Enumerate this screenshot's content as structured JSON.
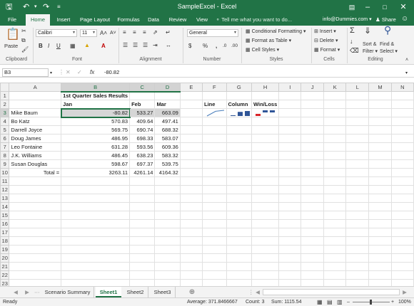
{
  "title_bar": {
    "title": "SampleExcel - Excel"
  },
  "tabs": [
    "File",
    "Home",
    "Insert",
    "Page Layout",
    "Formulas",
    "Data",
    "Review",
    "View"
  ],
  "tell_me": "Tell me what you want to do...",
  "user": "info@Dummies.com",
  "share": "Share",
  "ribbon": {
    "clipboard": {
      "label": "Clipboard",
      "paste": "Paste"
    },
    "font": {
      "label": "Font",
      "name": "Calibri",
      "size": "11"
    },
    "alignment": {
      "label": "Alignment"
    },
    "number": {
      "label": "Number",
      "format": "General"
    },
    "styles": {
      "label": "Styles",
      "conditional": "Conditional Formatting",
      "format_table": "Format as Table",
      "cell_styles": "Cell Styles"
    },
    "cells": {
      "label": "Cells",
      "insert": "Insert",
      "delete": "Delete",
      "format": "Format"
    },
    "editing": {
      "label": "Editing",
      "sort": "Sort &",
      "filter": "Filter",
      "find": "Find &",
      "select": "Select"
    }
  },
  "formula_bar": {
    "name_box": "B3",
    "fx": "fx",
    "value": "-80.82"
  },
  "columns": [
    "A",
    "B",
    "C",
    "D",
    "E",
    "F",
    "G",
    "H",
    "I",
    "J",
    "K",
    "L",
    "M",
    "N"
  ],
  "rows": [
    "1",
    "2",
    "3",
    "4",
    "5",
    "6",
    "7",
    "8",
    "9",
    "10",
    "11",
    "12",
    "13",
    "14",
    "15",
    "16",
    "17",
    "18",
    "19",
    "20",
    "21",
    "22",
    "23"
  ],
  "sheet": {
    "title": "1st Quarter Sales Results",
    "headers": [
      "Jan",
      "Feb",
      "Mar"
    ],
    "sparkline_headers": [
      "Line",
      "Column",
      "Win/Loss"
    ],
    "data": [
      {
        "name": "Mike Baum",
        "jan": "-80.82",
        "feb": "533.27",
        "mar": "663.09"
      },
      {
        "name": "Bo Katz",
        "jan": "570.83",
        "feb": "409.64",
        "mar": "497.41"
      },
      {
        "name": "Darrell Joyce",
        "jan": "569.75",
        "feb": "690.74",
        "mar": "688.32"
      },
      {
        "name": "Doug James",
        "jan": "486.95",
        "feb": "698.33",
        "mar": "583.07"
      },
      {
        "name": "Leo Fontaine",
        "jan": "631.28",
        "feb": "593.56",
        "mar": "609.36"
      },
      {
        "name": "J.K. Williams",
        "jan": "486.45",
        "feb": "638.23",
        "mar": "583.32"
      },
      {
        "name": "Susan Douglas",
        "jan": "598.67",
        "feb": "697.37",
        "mar": "539.75"
      }
    ],
    "total": {
      "label": "Total =",
      "jan": "3263.11",
      "feb": "4261.14",
      "mar": "4164.32"
    }
  },
  "sheet_tabs": [
    "Scenario Summary",
    "Sheet1",
    "Sheet2",
    "Sheet3"
  ],
  "status": {
    "ready": "Ready",
    "average": "Average: 371.8466667",
    "count": "Count: 3",
    "sum": "Sum: 1115.54",
    "zoom": "100%"
  },
  "colors": {
    "accent": "#217346",
    "win": "#2f5597",
    "loss": "#d9252a",
    "spark_line": "#4a7ebb",
    "spark_col": "#2f5597"
  }
}
